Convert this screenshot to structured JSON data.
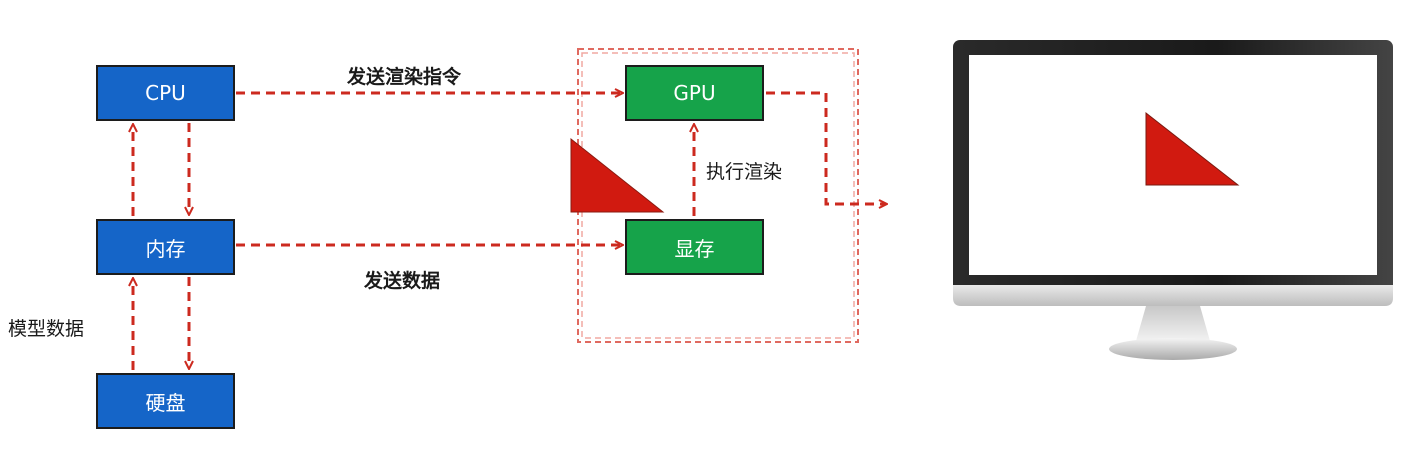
{
  "nodes": {
    "cpu": "CPU",
    "memory": "内存",
    "disk": "硬盘",
    "gpu": "GPU",
    "vram": "显存"
  },
  "edge_labels": {
    "send_render_command": "发送渲染指令",
    "send_data": "发送数据",
    "execute_render": "执行渲染",
    "model_data": "模型数据"
  },
  "colors": {
    "cpu_side_box": "#1565c8",
    "gpu_side_box": "#16a34a",
    "arrow": "#cc2a1f",
    "triangle": "#d11a10",
    "monitor_bezel": "#1f1f1f"
  },
  "icons": {
    "render_shape": "triangle-icon",
    "display": "monitor-icon"
  }
}
